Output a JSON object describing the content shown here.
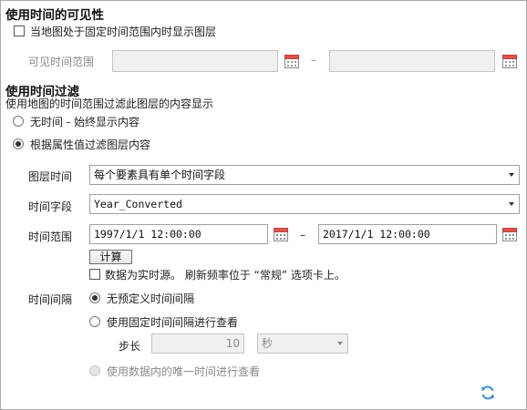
{
  "visibility": {
    "heading": "使用时间的可见性",
    "checkbox_label": "当地图处于固定时间范围内时显示图层",
    "range_label": "可见时间范围",
    "range_dash": "–",
    "start_value": "",
    "end_value": ""
  },
  "filter": {
    "heading": "使用时间过滤",
    "description": "使用地图的时间范围过滤此图层的内容显示",
    "radio_no_time": "无时间 - 始终显示内容",
    "radio_by_attribute": "根据属性值过滤图层内容",
    "layer_time_label": "图层时间",
    "layer_time_value": "每个要素具有单个时间字段",
    "time_field_label": "时间字段",
    "time_field_value": "Year_Converted",
    "time_range_label": "时间范围",
    "time_range_start": "1997/1/1 12:00:00",
    "time_range_dash": "–",
    "time_range_end": "2017/1/1 12:00:00",
    "calculate_button": "计算",
    "realtime_label": "数据为实时源。 刷新频率位于 “常规” 选项卡上。",
    "interval_label": "时间间隔",
    "radio_no_interval": "无预定义时间间隔",
    "radio_fixed_interval": "使用固定时间间隔进行查看",
    "step_label": "步长",
    "step_value": "10",
    "step_unit": "秒",
    "radio_unique_times": "使用数据内的唯一时间进行查看"
  },
  "colors": {
    "accent": "#3c8fd6",
    "calendar_red": "#d9534f"
  }
}
